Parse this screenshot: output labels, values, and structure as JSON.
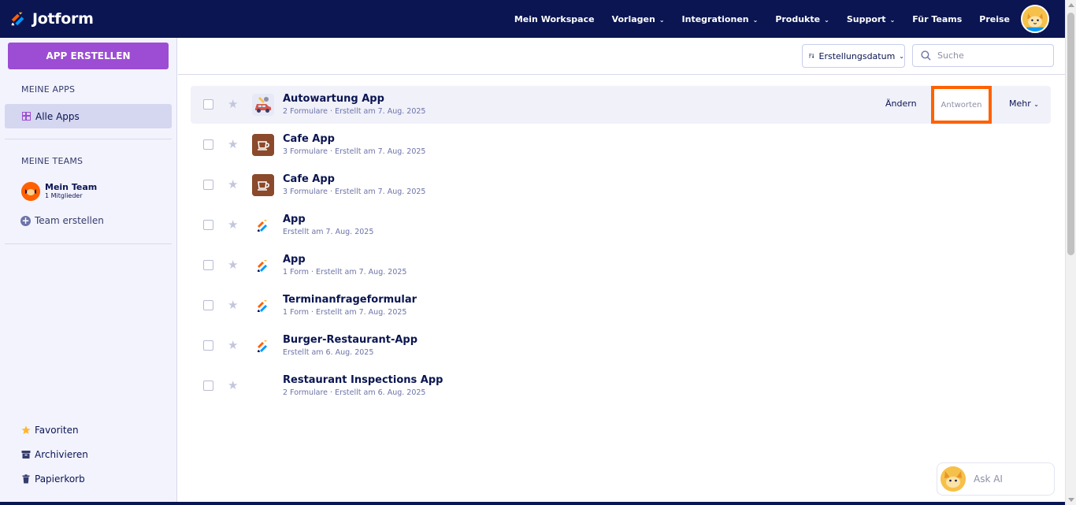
{
  "brand": {
    "name": "Jotform"
  },
  "nav": {
    "items": [
      {
        "label": "Mein Workspace",
        "dropdown": false
      },
      {
        "label": "Vorlagen",
        "dropdown": true
      },
      {
        "label": "Integrationen",
        "dropdown": true
      },
      {
        "label": "Produkte",
        "dropdown": true
      },
      {
        "label": "Support",
        "dropdown": true
      },
      {
        "label": "Für Teams",
        "dropdown": false
      },
      {
        "label": "Preise",
        "dropdown": false
      }
    ]
  },
  "sidebar": {
    "create_label": "APP ERSTELLEN",
    "my_apps_title": "MEINE APPS",
    "all_apps_label": "Alle Apps",
    "my_teams_title": "MEINE TEAMS",
    "team": {
      "name": "Mein Team",
      "members": "1 Mitglieder"
    },
    "create_team_label": "Team erstellen",
    "favorites_label": "Favoriten",
    "archive_label": "Archivieren",
    "trash_label": "Papierkorb"
  },
  "toolbar": {
    "sort_label": "Erstellungsdatum",
    "search_placeholder": "Suche"
  },
  "apps": [
    {
      "title": "Autowartung App",
      "meta": "2 Formulare · Erstellt am 7. Aug. 2025",
      "icon": "car-icon"
    },
    {
      "title": "Cafe App",
      "meta": "3 Formulare · Erstellt am 7. Aug. 2025",
      "icon": "coffee-cup-icon"
    },
    {
      "title": "Cafe App",
      "meta": "3 Formulare · Erstellt am 7. Aug. 2025",
      "icon": "coffee-cup-icon"
    },
    {
      "title": "App",
      "meta": "Erstellt am 7. Aug. 2025",
      "icon": "jotform-logo-icon"
    },
    {
      "title": "App",
      "meta": "1 Form · Erstellt am 7. Aug. 2025",
      "icon": "jotform-logo-icon"
    },
    {
      "title": "Terminanfrageformular",
      "meta": "1 Form · Erstellt am 7. Aug. 2025",
      "icon": "jotform-logo-icon"
    },
    {
      "title": "Burger-Restaurant-App",
      "meta": "Erstellt am 6. Aug. 2025",
      "icon": "jotform-logo-icon"
    },
    {
      "title": "Restaurant Inspections App",
      "meta": "2 Formulare · Erstellt am 6. Aug. 2025",
      "icon": "none"
    }
  ],
  "row_actions": {
    "edit_label": "Ändern",
    "responses_label": "Antworten",
    "more_label": "Mehr"
  },
  "ask_ai": {
    "label": "Ask AI"
  },
  "colors": {
    "navy": "#0a1551",
    "purple": "#9c4dd3",
    "highlight": "#ff6100"
  }
}
